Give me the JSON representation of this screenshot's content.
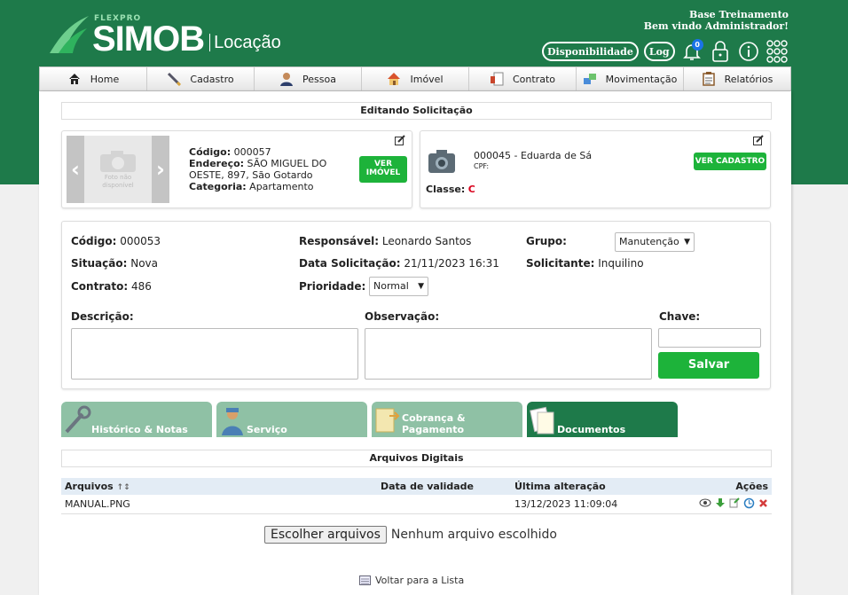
{
  "header": {
    "brand_small": "FLEXPRO",
    "brand_name": "SIMOB",
    "brand_module": "Locação",
    "company": "Base Treinamento",
    "welcome": "Bem vindo Administrador!",
    "availability_label": "Disponibilidade",
    "log_label": "Log",
    "notifications_count": "0"
  },
  "nav": [
    {
      "label": "Home",
      "icon": "home-icon"
    },
    {
      "label": "Cadastro",
      "icon": "pencil-icon"
    },
    {
      "label": "Pessoa",
      "icon": "person-icon"
    },
    {
      "label": "Imóvel",
      "icon": "house-icon"
    },
    {
      "label": "Contrato",
      "icon": "contract-icon"
    },
    {
      "label": "Movimentação",
      "icon": "transfer-icon"
    },
    {
      "label": "Relatórios",
      "icon": "clipboard-icon"
    }
  ],
  "editing_title": "Editando Solicitação",
  "property": {
    "photo_text": "Foto não disponível",
    "code_label": "Código:",
    "code": "000057",
    "address_label": "Endereço:",
    "address_1": "SÃO MIGUEL DO",
    "address_2": "OESTE, 897, São Gotardo",
    "category_label": "Categoria:",
    "category": "Apartamento",
    "view_button_1": "VER",
    "view_button_2": "IMÓVEL"
  },
  "person": {
    "name": "000045 - Eduarda de Sá",
    "cpf_label": "CPF:",
    "class_label": "Classe:",
    "class_value": "C",
    "view_button": "VER CADASTRO"
  },
  "request": {
    "code_label": "Código:",
    "code": "000053",
    "status_label": "Situação:",
    "status": "Nova",
    "contract_label": "Contrato:",
    "contract": "486",
    "responsible_label": "Responsável:",
    "responsible": "Leonardo Santos",
    "date_label": "Data Solicitação:",
    "date": "21/11/2023 16:31",
    "priority_label": "Prioridade:",
    "priority": "Normal",
    "group_label": "Grupo:",
    "group": "Manutenção",
    "requester_label": "Solicitante:",
    "requester": "Inquilino",
    "description_label": "Descrição:",
    "observation_label": "Observação:",
    "key_label": "Chave:",
    "save_label": "Salvar"
  },
  "tabs": [
    {
      "label": "Histórico & Notas",
      "icon": "wrench-icon"
    },
    {
      "label": "Serviço",
      "icon": "worker-icon"
    },
    {
      "label": "Cobrança & Pagamento",
      "icon": "billing-icon"
    },
    {
      "label": "Documentos",
      "icon": "documents-icon"
    }
  ],
  "files": {
    "title": "Arquivos Digitais",
    "columns": [
      "Arquivos",
      "Data de validade",
      "Última alteração",
      "Ações"
    ],
    "rows": [
      {
        "name": "MANUAL.PNG",
        "validity": "",
        "modified": "13/12/2023 11:09:04"
      }
    ],
    "choose_button": "Escolher arquivos",
    "no_file": "Nenhum arquivo escolhido"
  },
  "back_link": "Voltar para a Lista",
  "colors": {
    "brand_green": "#1e7a4a",
    "action_green": "#1db33a",
    "class_red": "#d9001b"
  }
}
